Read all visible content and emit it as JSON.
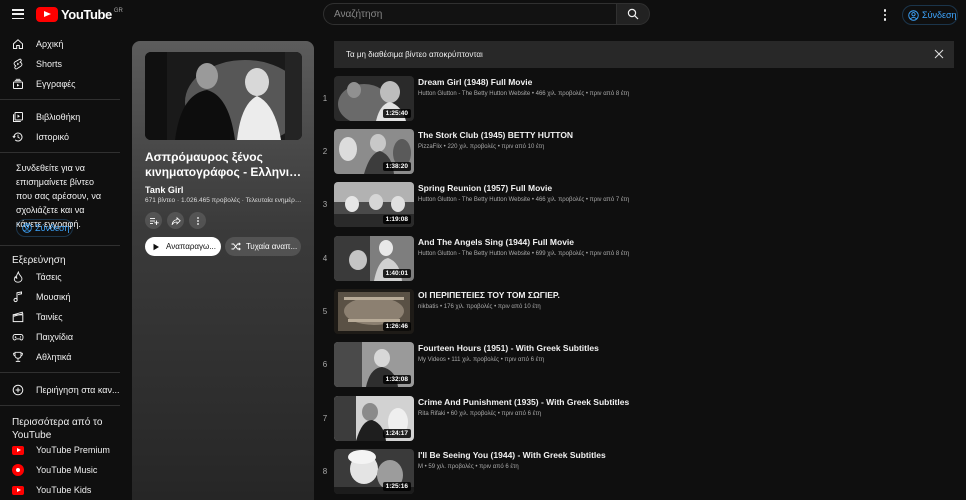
{
  "header": {
    "logo_text": "YouTube",
    "logo_region": "GR",
    "search_placeholder": "Αναζήτηση",
    "signin_label": "Σύνδεση"
  },
  "sidebar": {
    "main_items": [
      {
        "label": "Αρχική",
        "icon": "home-icon"
      },
      {
        "label": "Shorts",
        "icon": "shorts-icon"
      },
      {
        "label": "Εγγραφές",
        "icon": "subscriptions-icon"
      }
    ],
    "you_items": [
      {
        "label": "Βιβλιοθήκη",
        "icon": "library-icon"
      },
      {
        "label": "Ιστορικό",
        "icon": "history-icon"
      }
    ],
    "signin_prompt": "Συνδεθείτε για να επισημαίνετε βίντεο που σας αρέσουν, να σχολιάζετε και να κάνετε εγγραφή.",
    "signin_label": "Σύνδεση",
    "explore_heading": "Εξερεύνηση",
    "explore_items": [
      {
        "label": "Τάσεις",
        "icon": "trending-icon"
      },
      {
        "label": "Μουσική",
        "icon": "music-icon"
      },
      {
        "label": "Ταινίες",
        "icon": "movies-icon"
      },
      {
        "label": "Παιχνίδια",
        "icon": "gaming-icon"
      },
      {
        "label": "Αθλητικά",
        "icon": "sports-icon"
      }
    ],
    "browse_channels_label": "Περιήγηση στα καν...",
    "more_heading": "Περισσότερα από το YouTube",
    "more_items": [
      {
        "label": "YouTube Premium",
        "icon": "youtube-premium-icon"
      },
      {
        "label": "YouTube Music",
        "icon": "youtube-music-icon"
      },
      {
        "label": "YouTube Kids",
        "icon": "youtube-kids-icon"
      }
    ]
  },
  "playlist": {
    "title_line1": "Ασπρόμαυρος ξένος",
    "title_line2": "κινηματογράφος - Ελληνικοί...",
    "owner": "Tank Girl",
    "meta": "671 βίντεο · 1.026.465 προβολές · Τελευταία ενημέρωση...",
    "play_all_label": "Αναπαραγω...",
    "shuffle_label": "Τυχαία αναπ..."
  },
  "banner": {
    "text": "Τα μη διαθέσιμα βίντεο αποκρύπτονται"
  },
  "videos": [
    {
      "index": "1",
      "title": "Dream Girl (1948) Full Movie",
      "meta": "Hutton Glutton - The Betty Hutton Website • 466 χιλ. προβολές • πριν από 8 έτη",
      "duration": "1:25:40"
    },
    {
      "index": "2",
      "title": "The Stork Club (1945) BETTY HUTTON",
      "meta": "PizzaFlix • 220 χιλ. προβολές • πριν από 10 έτη",
      "duration": "1:38:20"
    },
    {
      "index": "3",
      "title": "Spring Reunion (1957) Full Movie",
      "meta": "Hutton Glutton - The Betty Hutton Website • 466 χιλ. προβολές • πριν από 7 έτη",
      "duration": "1:19:08"
    },
    {
      "index": "4",
      "title": "And The Angels Sing (1944) Full Movie",
      "meta": "Hutton Glutton - The Betty Hutton Website • 699 χιλ. προβολές • πριν από 8 έτη",
      "duration": "1:40:01"
    },
    {
      "index": "5",
      "title": "ΟΙ ΠΕΡΙΠΕΤΕΙΕΣ ΤΟΥ ΤΟΜ ΣΩΓΙΕΡ.",
      "meta": "nikbatis • 176 χιλ. προβολές • πριν από 10 έτη",
      "duration": "1:26:46"
    },
    {
      "index": "6",
      "title": "Fourteen Hours (1951) - With Greek Subtitles",
      "meta": "My Videos • 111 χιλ. προβολές • πριν από 6 έτη",
      "duration": "1:32:08"
    },
    {
      "index": "7",
      "title": "Crime And Punishment (1935) - With Greek Subtitles",
      "meta": "Rita Rifaki • 60 χιλ. προβολές • πριν από 6 έτη",
      "duration": "1:24:17"
    },
    {
      "index": "8",
      "title": "I'll Be Seeing You (1944) - With Greek Subtitles",
      "meta": "M • 59 χιλ. προβολές • πριν από 6 έτη",
      "duration": "1:25:16"
    }
  ]
}
